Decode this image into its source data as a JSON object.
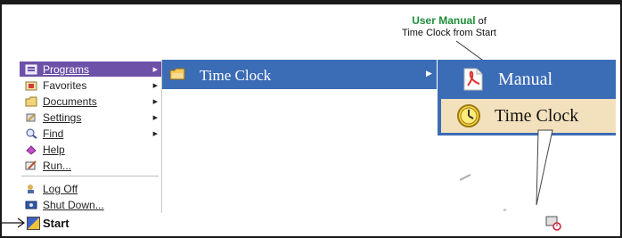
{
  "callout": {
    "title": "User Manual",
    "suffix": "of",
    "line2": "Time Clock from Start"
  },
  "start_menu": {
    "items": [
      {
        "label": "Programs",
        "icon": "programs-icon",
        "has_submenu": true,
        "active": true
      },
      {
        "label": "Favorites",
        "icon": "favorites-icon",
        "has_submenu": true
      },
      {
        "label": "Documents",
        "icon": "documents-icon",
        "has_submenu": true
      },
      {
        "label": "Settings",
        "icon": "settings-icon",
        "has_submenu": true
      },
      {
        "label": "Find",
        "icon": "find-icon",
        "has_submenu": true
      },
      {
        "label": "Help",
        "icon": "help-icon",
        "has_submenu": false
      },
      {
        "label": "Run...",
        "icon": "run-icon",
        "has_submenu": false
      },
      {
        "label": "Log Off",
        "icon": "log-off-icon",
        "has_submenu": false
      },
      {
        "label": "Shut Down...",
        "icon": "shut-down-icon",
        "has_submenu": false
      }
    ]
  },
  "programs_submenu": {
    "item": "Time Clock"
  },
  "time_clock_submenu": {
    "items": [
      "Manual",
      "Time Clock"
    ]
  },
  "taskbar": {
    "start_label": "Start"
  },
  "colors": {
    "menu_highlight": "#3b6cb6",
    "programs_highlight": "#6d51a8",
    "selected_item": "#f3e1bd",
    "callout_title": "#1f8f3a"
  }
}
